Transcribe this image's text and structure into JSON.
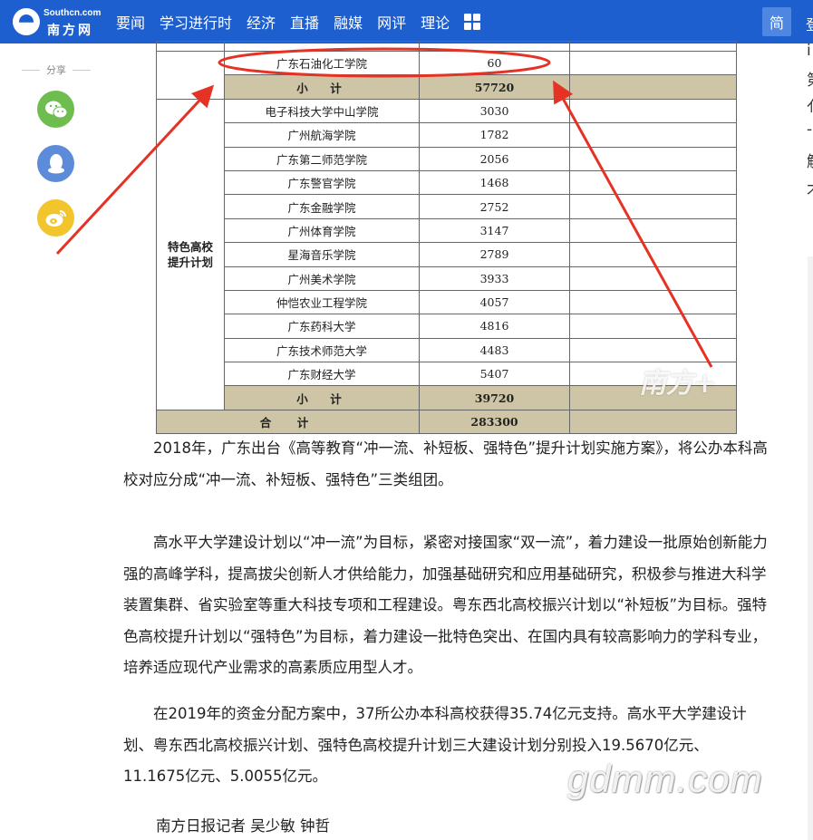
{
  "site": {
    "logo_en": "Southcn.com",
    "logo_cn": "南方网",
    "brand_color": "#1e5fd0"
  },
  "nav": {
    "items": [
      "要闻",
      "学习进行时",
      "经济",
      "直播",
      "融媒",
      "网评",
      "理论"
    ],
    "grid_icon": "grid-icon",
    "lang_toggle": "简"
  },
  "share": {
    "label": "分享",
    "buttons": [
      {
        "name": "wechat-icon",
        "color": "#6ebd4f"
      },
      {
        "name": "qq-icon",
        "color": "#5b8bd9"
      },
      {
        "name": "weibo-icon",
        "color": "#f2c52d"
      }
    ]
  },
  "table": {
    "top_rows": [
      {
        "name": "",
        "value": ""
      },
      {
        "name": "广东石油化工学院",
        "value": "60"
      }
    ],
    "subtotal_1": {
      "label": "小　计",
      "value": "57720"
    },
    "group_label": "特色高校提升计划",
    "group_rows": [
      {
        "name": "电子科技大学中山学院",
        "value": "3030"
      },
      {
        "name": "广州航海学院",
        "value": "1782"
      },
      {
        "name": "广东第二师范学院",
        "value": "2056"
      },
      {
        "name": "广东警官学院",
        "value": "1468"
      },
      {
        "name": "广东金融学院",
        "value": "2752"
      },
      {
        "name": "广州体育学院",
        "value": "3147"
      },
      {
        "name": "星海音乐学院",
        "value": "2789"
      },
      {
        "name": "广州美术学院",
        "value": "3933"
      },
      {
        "name": "仲恺农业工程学院",
        "value": "4057"
      },
      {
        "name": "广东药科大学",
        "value": "4816"
      },
      {
        "name": "广东技术师范大学",
        "value": "4483"
      },
      {
        "name": "广东财经大学",
        "value": "5407"
      }
    ],
    "subtotal_2": {
      "label": "小　计",
      "value": "39720"
    },
    "total": {
      "label": "合　计",
      "value": "283300"
    },
    "highlight_color": "#e53224"
  },
  "article": {
    "p1": "2018年，广东出台《高等教育“冲一流、补短板、强特色”提升计划实施方案》，将公办本科高校对应分成“冲一流、补短板、强特色”三类组团。",
    "p2": "高水平大学建设计划以“冲一流”为目标，紧密对接国家“双一流”，着力建设一批原始创新能力强的高峰学科，提高拔尖创新人才供给能力，加强基础研究和应用基础研究，积极参与推进大科学装置集群、省实验室等重大科技专项和工程建设。粤东西北高校振兴计划以“补短板”为目标。强特色高校提升计划以“强特色”为目标，着力建设一批特色突出、在国内具有较高影响力的学科专业，培养适应现代产业需求的高素质应用型人才。",
    "p3": "在2019年的资金分配方案中，37所公办本科高校获得35.74亿元支持。高水平大学建设计划、粤东西北高校振兴计划、强特色高校提升计划三大建设计划分别投入19.5670亿元、11.1675亿元、5.0055亿元。",
    "byline": "南方日报记者 吴少敏 钟哲"
  },
  "right_column": {
    "chars": [
      "i",
      "第",
      "亻",
      "-",
      "解",
      "才"
    ]
  },
  "watermarks": {
    "south": "南方+",
    "gdmm": "gdmm.com"
  }
}
